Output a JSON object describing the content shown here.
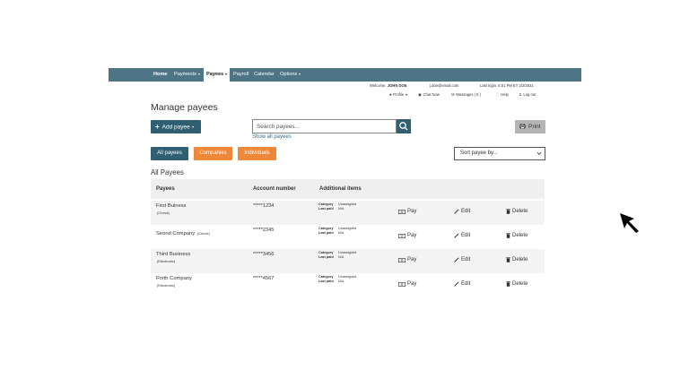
{
  "nav": {
    "items": [
      {
        "label": "Home",
        "dropdown": false
      },
      {
        "label": "Payments",
        "dropdown": true
      },
      {
        "label": "Payees",
        "dropdown": true,
        "active": true
      },
      {
        "label": "Payroll",
        "dropdown": false
      },
      {
        "label": "Calendar",
        "dropdown": false
      },
      {
        "label": "Options",
        "dropdown": true
      }
    ],
    "color": "#4d7585"
  },
  "utility": {
    "welcome_prefix": "Welcome:",
    "user_name": "JOHN DOE",
    "email": "j.doe@email.com",
    "last_login": "Last login: 6:01 PM ET  2/2/2021",
    "profile": "Profile",
    "chat": "Chat Now",
    "messages": "Messages ( 5 )",
    "help": "Help",
    "logout": "Log out"
  },
  "page": {
    "title": "Manage payees",
    "add_payee": "Add payee",
    "search_placeholder": "Search payees...",
    "show_all": "Show all payees",
    "print": "Print",
    "filters": {
      "all": "All payees",
      "companies": "Companies",
      "individuals": "Individuals"
    },
    "sort_placeholder": "Sort payee by...",
    "section_title": "All Payees",
    "primary_color": "#2f5f70",
    "accent_color": "#f0883a"
  },
  "table": {
    "headers": {
      "payees": "Payees",
      "account": "Account number",
      "additional": "Additional items"
    },
    "meta_labels": {
      "category": "Category",
      "last_paid": "Last paid"
    },
    "actions": {
      "pay": "Pay",
      "edit": "Edit",
      "delete": "Delete"
    },
    "rows": [
      {
        "name": "First Buiness",
        "type": "(Check)",
        "account": "*****1234",
        "category": "Unassigned",
        "last_paid": "N/A"
      },
      {
        "name": "Seond Company",
        "type": "(Check)",
        "account": "*****2345",
        "category": "Unassigned",
        "last_paid": "N/A"
      },
      {
        "name": "Third Business",
        "type": "(Electronic)",
        "account": "*****3456",
        "category": "Unassigned",
        "last_paid": "N/A"
      },
      {
        "name": "Forth Company",
        "type": "(Electronic)",
        "account": "*****4567",
        "category": "Unassigned",
        "last_paid": "N/A"
      }
    ]
  }
}
